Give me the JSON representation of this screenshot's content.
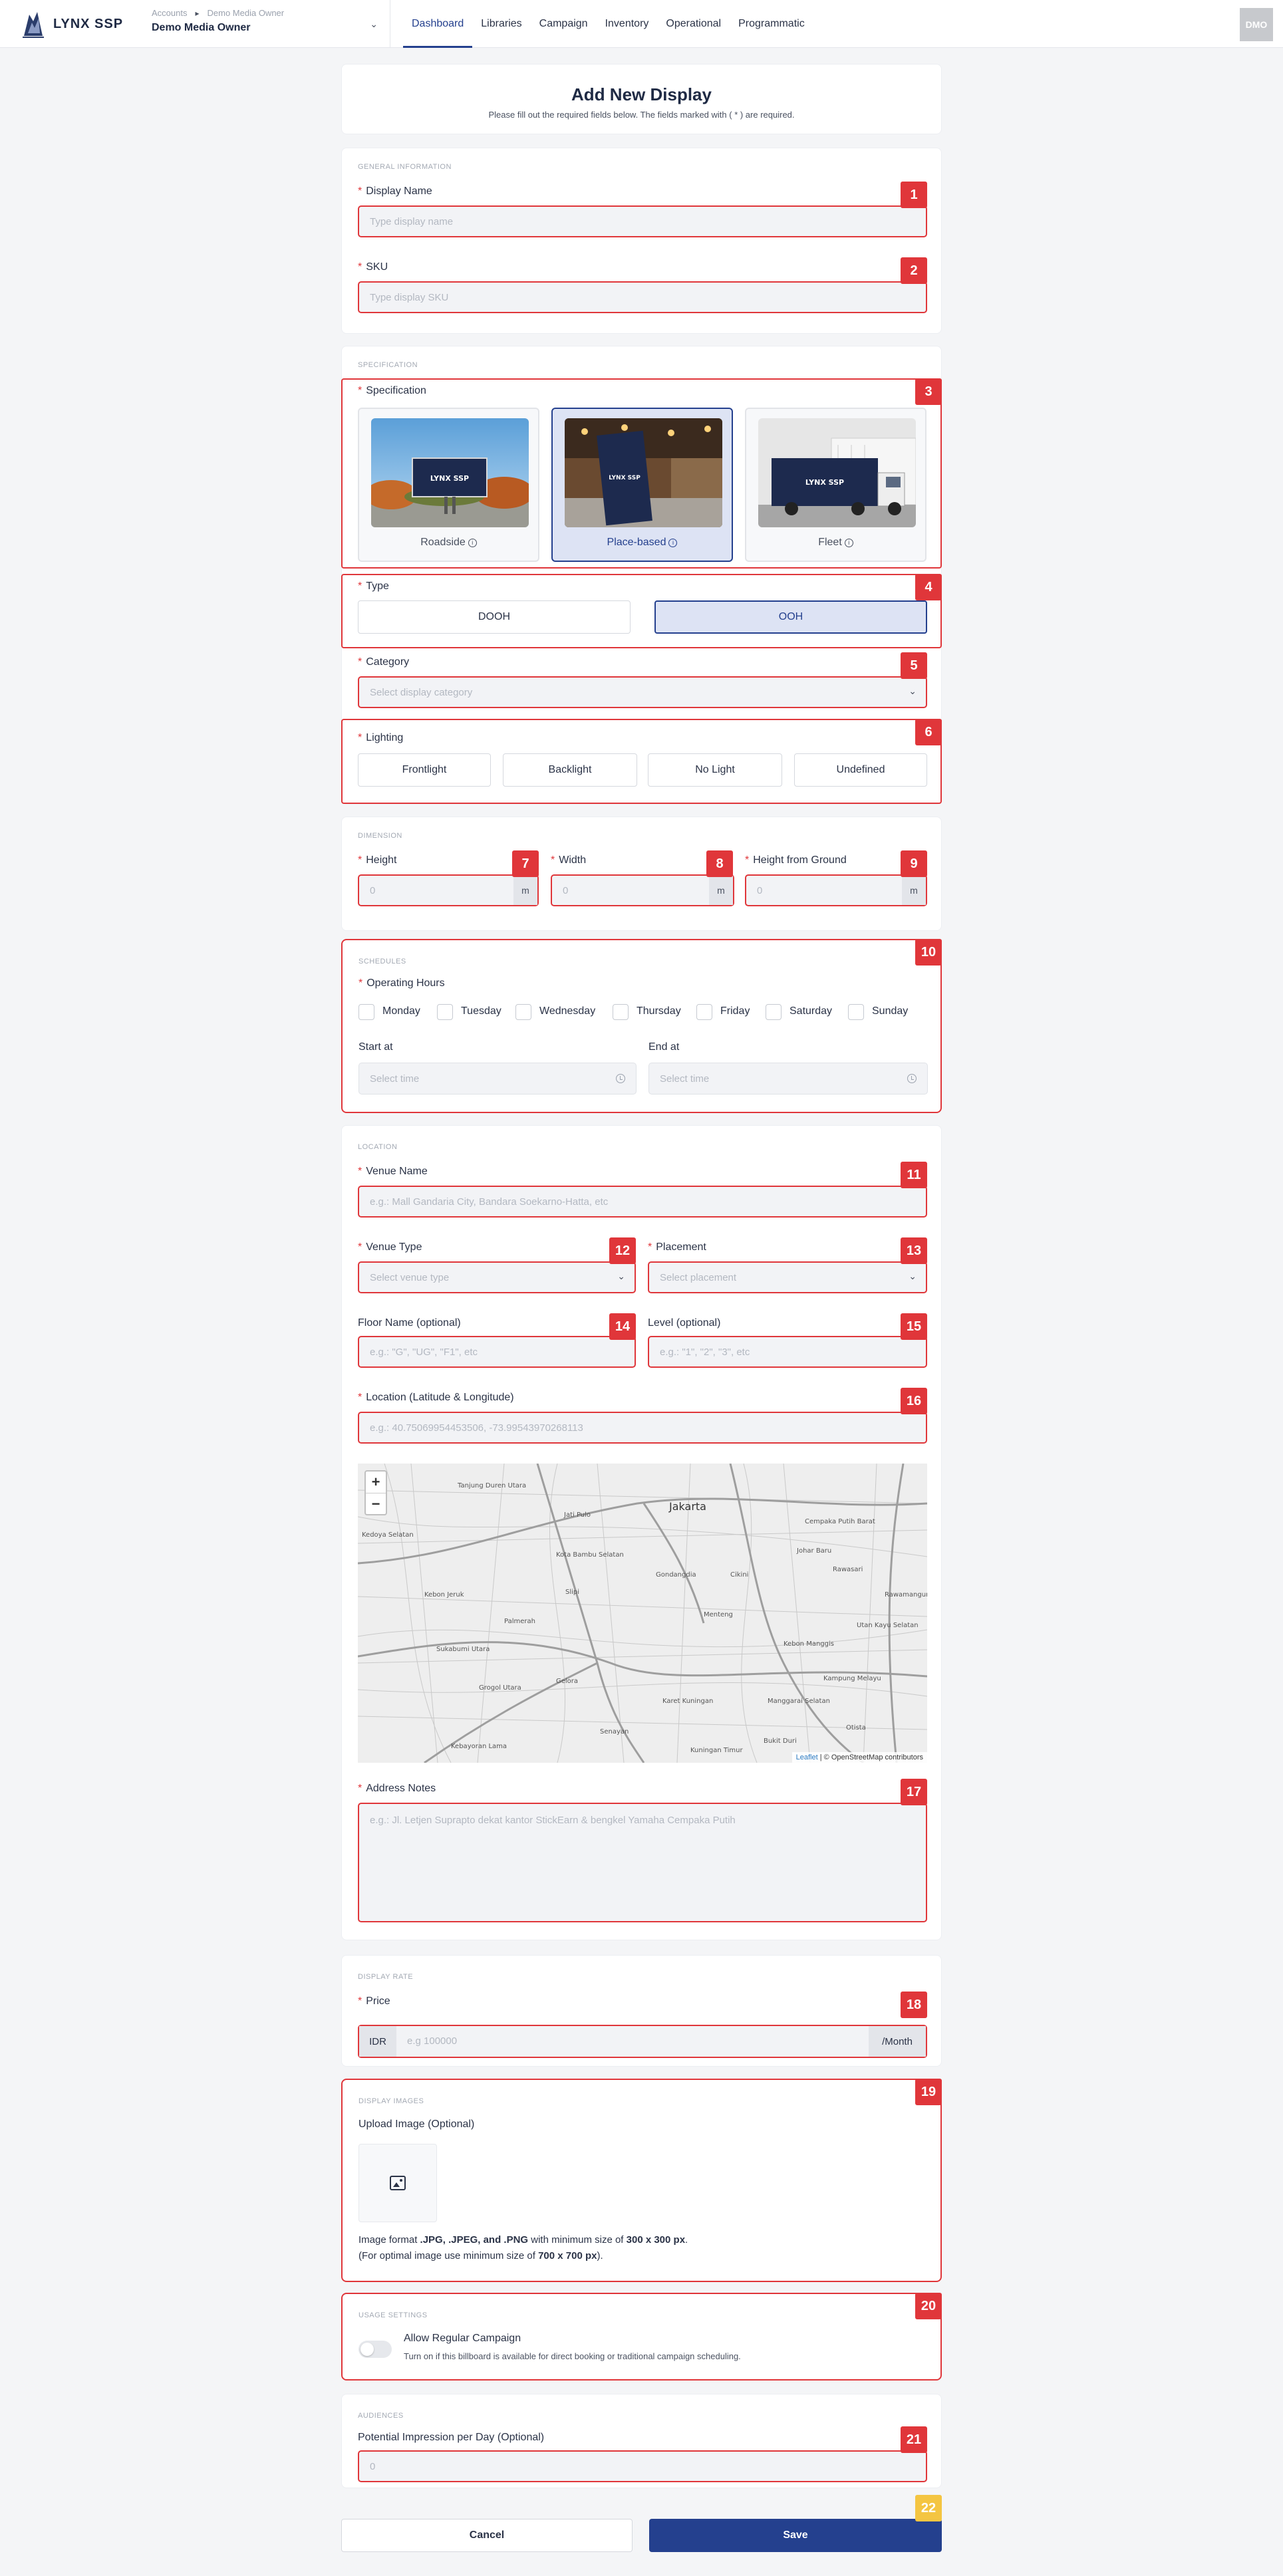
{
  "nav": {
    "logo_text": "LYNX SSP",
    "breadcrumb_root": "Accounts",
    "breadcrumb_current": "Demo Media Owner",
    "account_name": "Demo Media Owner",
    "tabs": [
      "Dashboard",
      "Libraries",
      "Campaign",
      "Inventory",
      "Operational",
      "Programmatic"
    ],
    "active_tab": "Dashboard",
    "avatar_initials": "DMO"
  },
  "header": {
    "title": "Add New Display",
    "subtitle": "Please fill out the required fields below. The fields marked with ( * ) are required."
  },
  "general": {
    "section": "GENERAL INFORMATION",
    "display_name_label": "Display Name",
    "display_name_placeholder": "Type display name",
    "sku_label": "SKU",
    "sku_placeholder": "Type display SKU"
  },
  "specification": {
    "section": "SPECIFICATION",
    "label": "Specification",
    "options": [
      "Roadside",
      "Place-based",
      "Fleet"
    ],
    "selected": "Place-based",
    "type_label": "Type",
    "types": [
      "DOOH",
      "OOH"
    ],
    "selected_type": "OOH",
    "category_label": "Category",
    "category_placeholder": "Select display category",
    "lighting_label": "Lighting",
    "lighting_options": [
      "Frontlight",
      "Backlight",
      "No Light",
      "Undefined"
    ],
    "billboard_text": "LYNX SSP"
  },
  "dimension": {
    "section": "DIMENSION",
    "height_label": "Height",
    "width_label": "Width",
    "ground_label": "Height from Ground",
    "placeholder": "0",
    "unit": "m"
  },
  "schedules": {
    "section": "SCHEDULES",
    "label": "Operating Hours",
    "days": [
      "Monday",
      "Tuesday",
      "Wednesday",
      "Thursday",
      "Friday",
      "Saturday",
      "Sunday"
    ],
    "start_label": "Start at",
    "end_label": "End at",
    "time_placeholder": "Select time"
  },
  "location": {
    "section": "LOCATION",
    "venue_name_label": "Venue Name",
    "venue_name_placeholder": "e.g.: Mall Gandaria City, Bandara Soekarno-Hatta, etc",
    "venue_type_label": "Venue Type",
    "venue_type_placeholder": "Select venue type",
    "placement_label": "Placement",
    "placement_placeholder": "Select placement",
    "floor_label": "Floor Name (optional)",
    "floor_placeholder": "e.g.: \"G\", \"UG\", \"F1\", etc",
    "level_label": "Level (optional)",
    "level_placeholder": "e.g.: \"1\", \"2\", \"3\", etc",
    "latlng_label": "Location (Latitude & Longitude)",
    "latlng_placeholder": "e.g.: 40.75069954453506, -73.99543970268113",
    "map_zoom_in": "+",
    "map_zoom_out": "−",
    "map_attribution_leaflet": "Leaflet",
    "map_attribution_osm": "© OpenStreetMap contributors",
    "map_labels": [
      "Tanjung Duren Utara",
      "Jakarta",
      "Cempaka Putih Barat",
      "Kedoya Selatan",
      "Jati Pulo",
      "Kota Bambu Selatan",
      "Kebon Jeruk",
      "Palmerah",
      "Slipi",
      "Gondangdia",
      "Cikini",
      "Johar Baru",
      "Rawasari",
      "Rawamangun",
      "Kebon Manggis",
      "Utan Kayu Selatan",
      "Kampung Melayu",
      "Sukabumi Utara",
      "Grogol Utara",
      "Gelora",
      "Senayan",
      "Karet Kuningan",
      "Manggarai Selatan",
      "Otista",
      "Kebayoran Lama",
      "Kuningan Timur",
      "Menteng",
      "Bukit Duri"
    ],
    "address_label": "Address Notes",
    "address_placeholder": "e.g.: Jl. Letjen Suprapto dekat kantor StickEarn & bengkel Yamaha Cempaka Putih"
  },
  "rate": {
    "section": "DISPLAY RATE",
    "price_label": "Price",
    "currency": "IDR",
    "price_placeholder": "e.g 100000",
    "per": "/Month"
  },
  "images": {
    "section": "DISPLAY IMAGES",
    "upload_label": "Upload Image (Optional)",
    "format_prefix": "Image format ",
    "format_bold": ".JPG, .JPEG, and .PNG",
    "format_mid": " with minimum size of ",
    "format_size": "300 x 300 px",
    "format_end": ".",
    "optimal_prefix": "(For optimal image use minimum size of ",
    "optimal_size": "700 x 700 px",
    "optimal_end": ")."
  },
  "usage": {
    "section": "USAGE SETTINGS",
    "toggle_label": "Allow Regular Campaign",
    "toggle_desc": "Turn on if this billboard is available for direct booking or traditional campaign scheduling.",
    "toggle_on": false
  },
  "audiences": {
    "section": "AUDIENCES",
    "label": "Potential Impression per Day (Optional)",
    "placeholder": "0"
  },
  "actions": {
    "cancel": "Cancel",
    "save": "Save"
  },
  "badges": [
    "1",
    "2",
    "3",
    "4",
    "5",
    "6",
    "7",
    "8",
    "9",
    "10",
    "11",
    "12",
    "13",
    "14",
    "15",
    "16",
    "17",
    "18",
    "19",
    "20",
    "21",
    "22"
  ],
  "colors": {
    "accent": "#24408e",
    "error": "#e0363a",
    "highlight": "#f4c542"
  }
}
